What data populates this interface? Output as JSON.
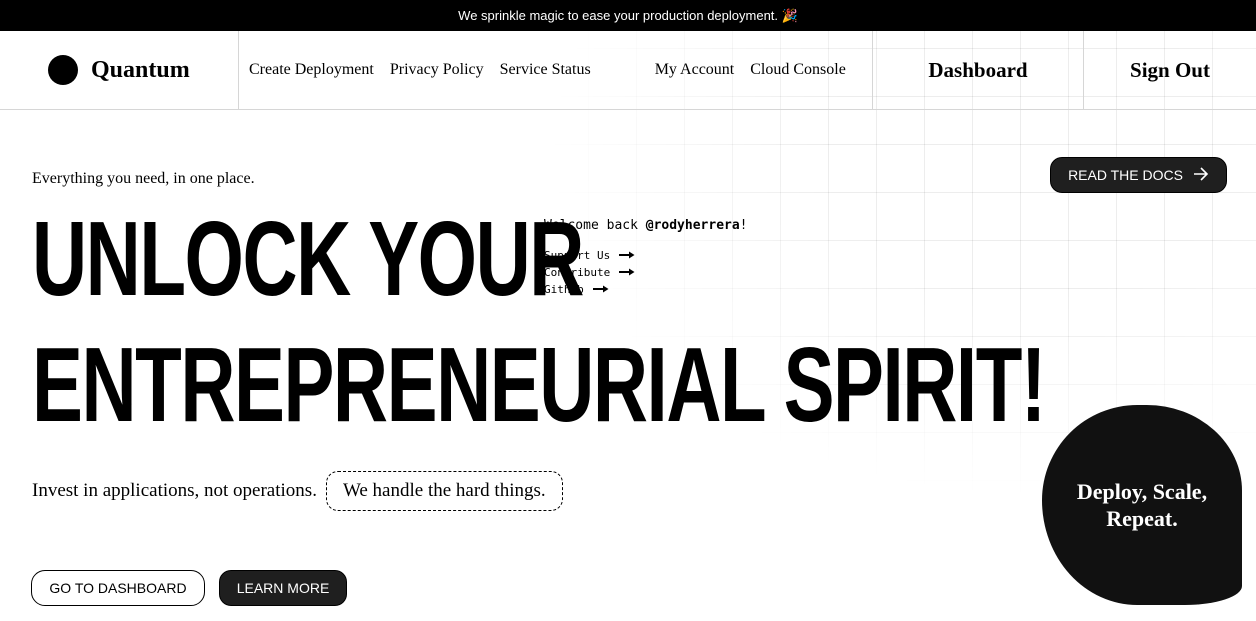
{
  "announcement": {
    "text": "We sprinkle magic to ease your production deployment. 🎉"
  },
  "brand": {
    "name": "Quantum"
  },
  "nav": {
    "links": [
      {
        "label": "Create Deployment"
      },
      {
        "label": "Privacy Policy"
      },
      {
        "label": "Service Status"
      },
      {
        "label": "My Account"
      },
      {
        "label": "Cloud Console"
      }
    ],
    "dashboard": "Dashboard",
    "sign_out": "Sign Out"
  },
  "hero": {
    "tagline": "Everything you need, in one place.",
    "title_line1": "UNLOCK YOUR",
    "title_line2": "ENTREPRENEURIAL SPIRIT!",
    "invest_text": "Invest in applications, not operations.",
    "handle_text": "We handle the hard things.",
    "docs_button": "READ THE DOCS",
    "primary_button": "GO TO DASHBOARD",
    "secondary_button": "LEARN MORE"
  },
  "welcome": {
    "prefix": "Welcome back ",
    "username": "@rodyherrera",
    "suffix": "!"
  },
  "side_links": [
    {
      "label": "Support Us",
      "icon": "long-arrow-right-icon"
    },
    {
      "label": "Contribute",
      "icon": "long-arrow-right-icon"
    },
    {
      "label": "Github",
      "icon": "long-arrow-right-icon"
    }
  ],
  "blob": {
    "text": "Deploy, Scale, Repeat."
  }
}
